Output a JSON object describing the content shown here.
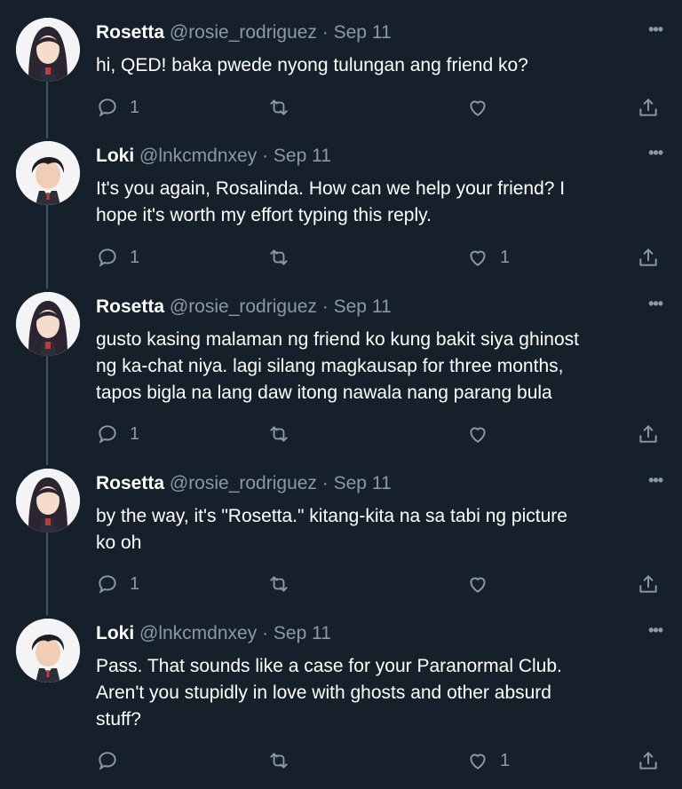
{
  "tweets": [
    {
      "name": "Rosetta",
      "handle": "@rosie_rodriguez",
      "dot": "·",
      "date": "Sep 11",
      "lines": [
        "hi, QED! baka pwede nyong tulungan ang friend ko?"
      ],
      "replies": "1",
      "likes": ""
    },
    {
      "name": "Loki",
      "handle": "@lnkcmdnxey",
      "dot": "·",
      "date": "Sep 11",
      "lines": [
        "It's you again, Rosalinda. How can we help your friend? I",
        "hope it's worth my effort typing this reply."
      ],
      "replies": "1",
      "likes": "1"
    },
    {
      "name": "Rosetta",
      "handle": "@rosie_rodriguez",
      "dot": "·",
      "date": "Sep 11",
      "lines": [
        "gusto kasing malaman ng friend ko kung bakit siya ghinost",
        "ng ka-chat niya. lagi silang magkausap for three months,",
        "tapos bigla na lang daw itong nawala nang parang bula"
      ],
      "replies": "1",
      "likes": ""
    },
    {
      "name": "Rosetta",
      "handle": "@rosie_rodriguez",
      "dot": "·",
      "date": "Sep 11",
      "lines": [
        "by the way, it's \"Rosetta.\" kitang-kita na sa tabi ng picture",
        "ko oh"
      ],
      "replies": "1",
      "likes": ""
    },
    {
      "name": "Loki",
      "handle": "@lnkcmdnxey",
      "dot": "·",
      "date": "Sep 11",
      "lines": [
        "Pass. That sounds like a case for your Paranormal Club.",
        "Aren't you stupidly in love with ghosts and other absurd",
        "stuff?"
      ],
      "replies": "",
      "likes": "1"
    }
  ],
  "icons": {
    "reply": "reply-icon",
    "retweet": "retweet-icon",
    "like": "heart-icon",
    "share": "share-icon",
    "more": "more-icon"
  },
  "colors": {
    "background": "#15202b",
    "muted": "#8b98a5",
    "thread": "#3d5466"
  }
}
